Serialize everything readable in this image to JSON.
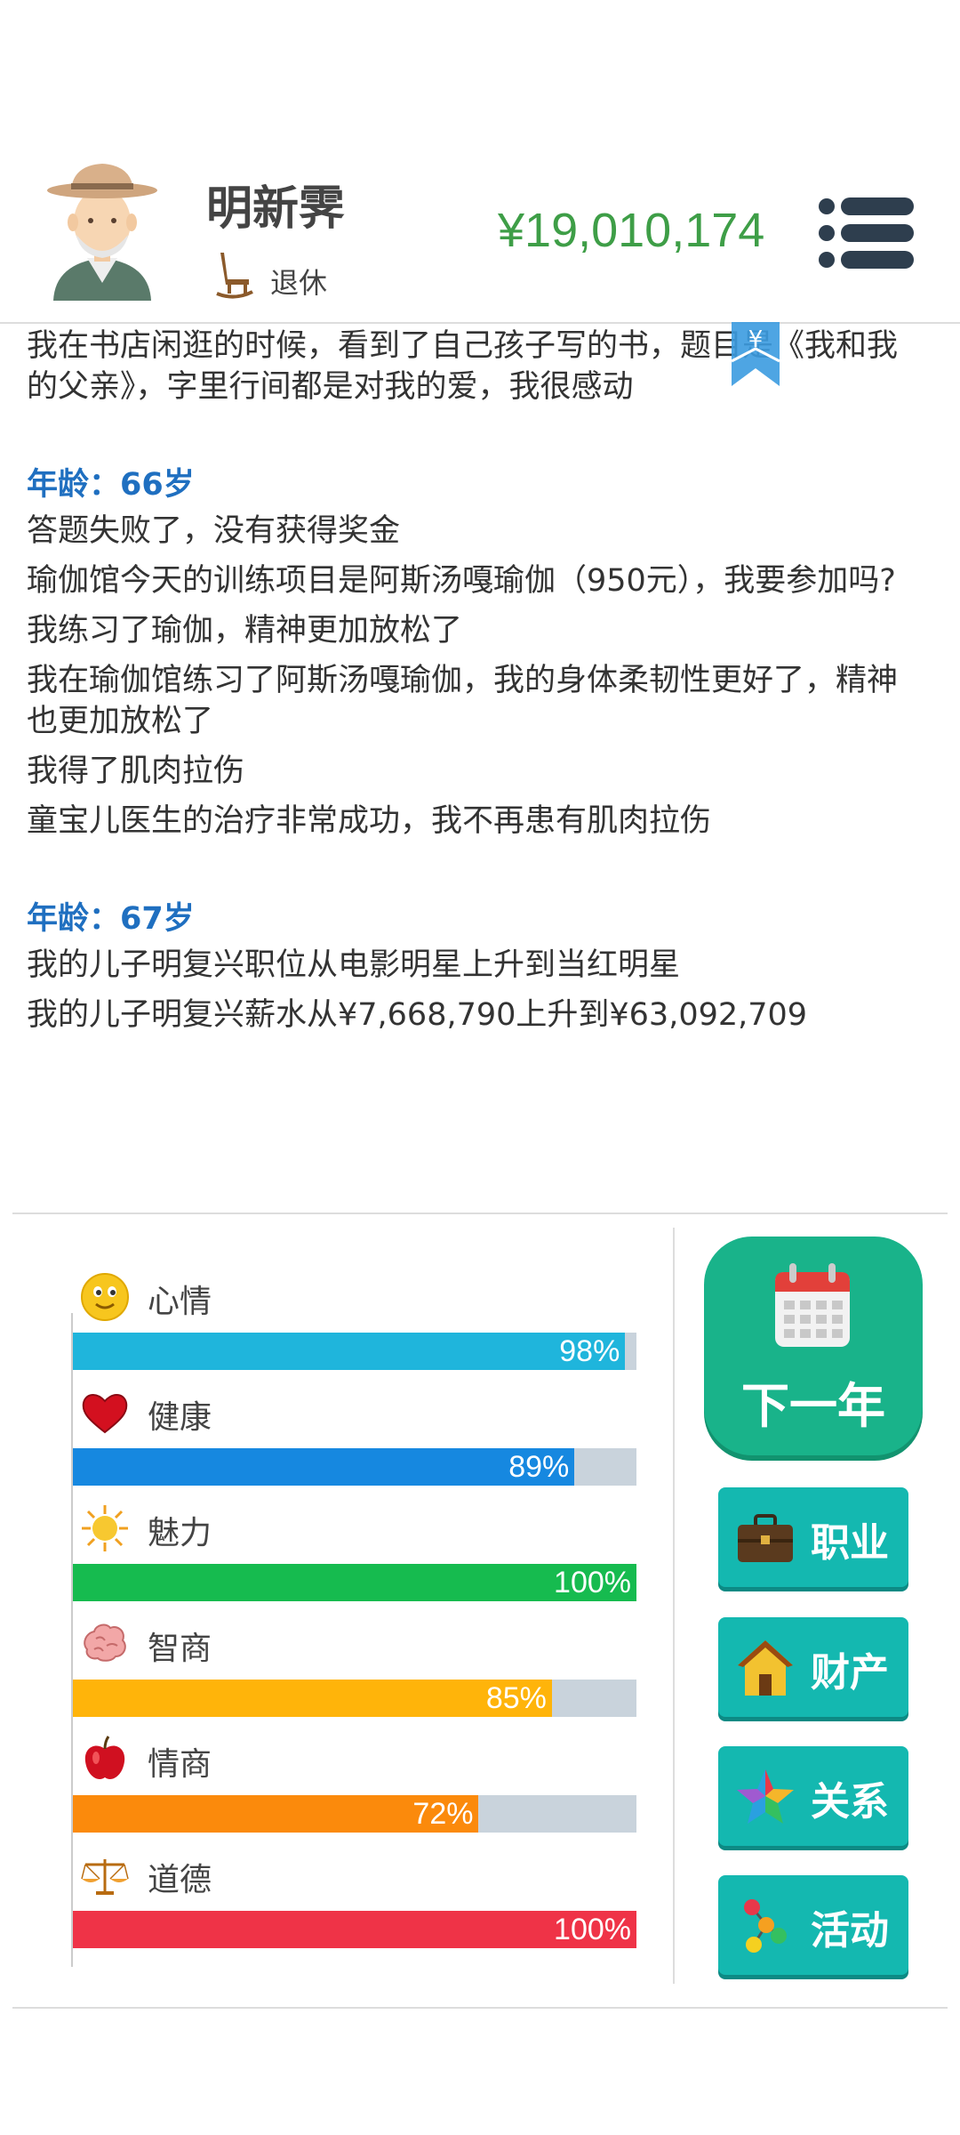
{
  "header": {
    "name": "明新霁",
    "job": "退休",
    "money": "¥19,010,174"
  },
  "log": {
    "first_entry": "我在书店闲逛的时候，看到了自己孩子写的书，题目是《我和我的父亲》，字里行间都是对我的爱，我很感动",
    "blocks": [
      {
        "age": "年龄：66岁",
        "entries": [
          "答题失败了，没有获得奖金",
          "瑜伽馆今天的训练项目是阿斯汤嘎瑜伽（950元），我要参加吗?",
          "我练习了瑜伽，精神更加放松了",
          "我在瑜伽馆练习了阿斯汤嘎瑜伽，我的身体柔韧性更好了，精神也更加放松了",
          "我得了肌肉拉伤",
          "童宝儿医生的治疗非常成功，我不再患有肌肉拉伤"
        ]
      },
      {
        "age": "年龄：67岁",
        "entries": [
          "我的儿子明复兴职位从电影明星上升到当红明星",
          "我的儿子明复兴薪水从¥7,668,790上升到¥63,092,709"
        ]
      }
    ]
  },
  "stats": [
    {
      "label": "心情",
      "percent": 98,
      "value": "98%",
      "color": "#1fb5dc",
      "icon": "smiley-icon"
    },
    {
      "label": "健康",
      "percent": 89,
      "value": "89%",
      "color": "#1688e0",
      "icon": "heart-icon"
    },
    {
      "label": "魅力",
      "percent": 100,
      "value": "100%",
      "color": "#16bb4f",
      "icon": "sun-icon"
    },
    {
      "label": "智商",
      "percent": 85,
      "value": "85%",
      "color": "#ffb40a",
      "icon": "brain-icon"
    },
    {
      "label": "情商",
      "percent": 72,
      "value": "72%",
      "color": "#fb8a0c",
      "icon": "apple-icon"
    },
    {
      "label": "道德",
      "percent": 100,
      "value": "100%",
      "color": "#ef3347",
      "icon": "scales-icon"
    }
  ],
  "buttons": {
    "next_year": "下一年",
    "career": "职业",
    "assets": "财产",
    "relations": "关系",
    "activities": "活动"
  }
}
